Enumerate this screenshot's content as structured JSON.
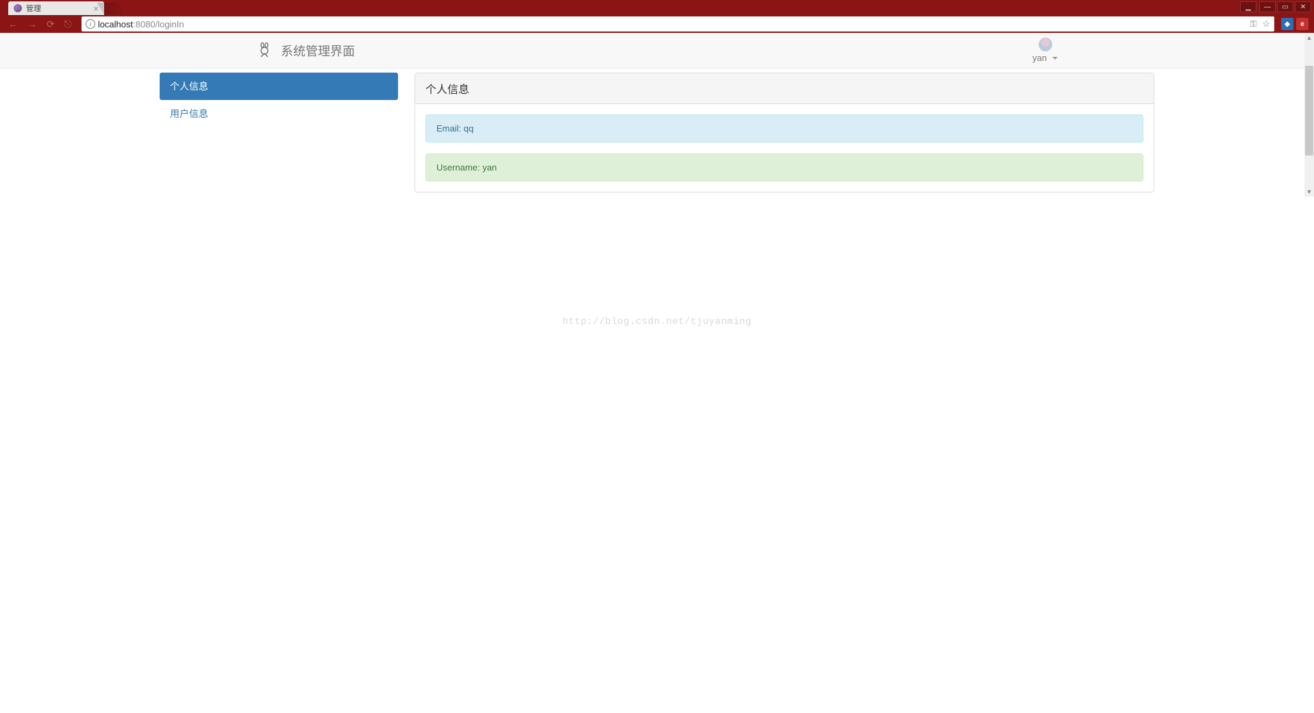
{
  "browser": {
    "tab_title": "管理",
    "url_full": "localhost:8080/loginIn",
    "url_host": "localhost",
    "url_port": ":8080",
    "url_path": "/loginIn"
  },
  "navbar": {
    "title": "系统管理界面",
    "user_name": "yan"
  },
  "sidebar": {
    "items": [
      {
        "label": "个人信息",
        "active": true
      },
      {
        "label": "用户信息",
        "active": false
      }
    ]
  },
  "main": {
    "panel_title": "个人信息",
    "email_row": "Email: qq",
    "username_row": "Username: yan"
  },
  "watermark": "http://blog.csdn.net/tjuyanming"
}
